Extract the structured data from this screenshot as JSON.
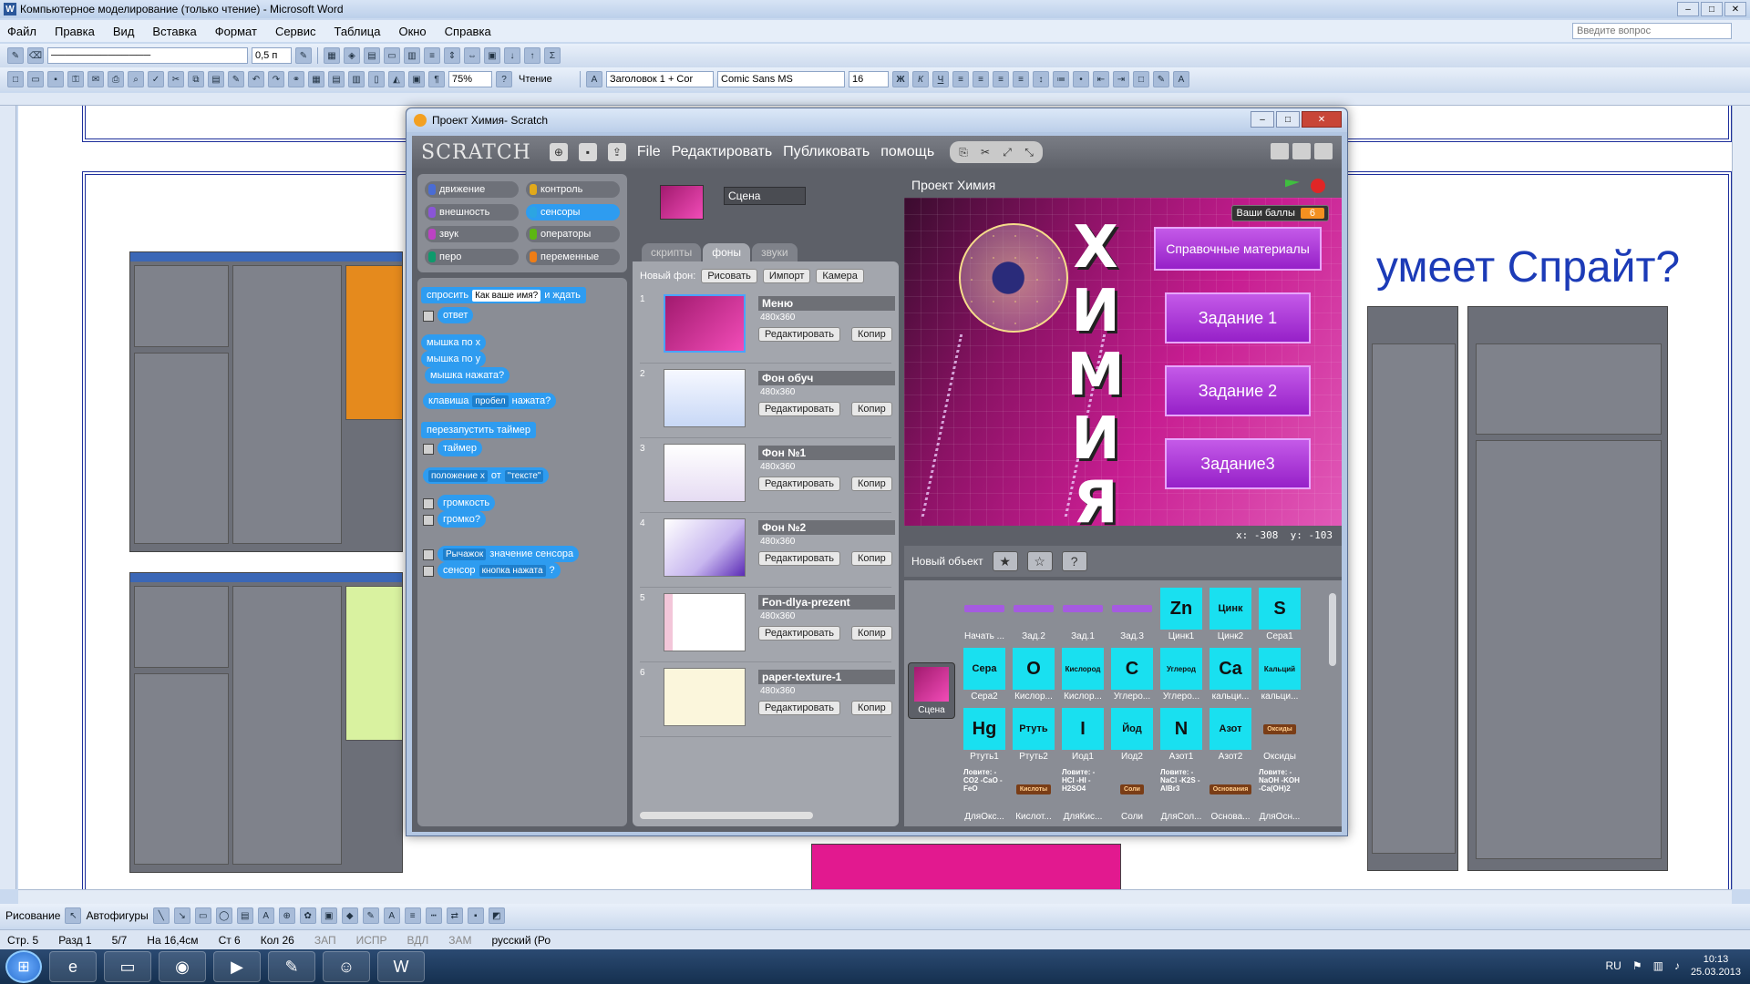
{
  "word": {
    "title": "Компьютерное моделирование (только чтение) - Microsoft Word",
    "menu": [
      "Файл",
      "Правка",
      "Вид",
      "Вставка",
      "Формат",
      "Сервис",
      "Таблица",
      "Окно",
      "Справка"
    ],
    "ask_placeholder": "Введите вопрос",
    "line_width": "0,5 п",
    "zoom": "75%",
    "reading": "Чтение",
    "style": "Заголовок 1 + Cor",
    "font": "Comic Sans MS",
    "font_size": "16",
    "heading_text": "умеет Спрайт?",
    "draw_label": "Рисование",
    "autoshapes_label": "Автофигуры",
    "status": {
      "page": "Стр. 5",
      "section": "Разд 1",
      "pages": "5/7",
      "at": "На 16,4см",
      "line": "Ст 6",
      "col": "Кол 26",
      "rec": "ЗАП",
      "trk": "ИСПР",
      "ext": "ВДЛ",
      "ovr": "ЗАМ",
      "lang": "русский (Ро"
    }
  },
  "taskbar": {
    "lang": "RU",
    "time": "10:13",
    "date": "25.03.2013"
  },
  "scratch": {
    "window_title": "Проект Химия- Scratch",
    "logo": "SCRATCH",
    "menu": [
      "File",
      "Редактировать",
      "Публиковать",
      "помощь"
    ],
    "categories": [
      {
        "label": "движение",
        "color": "#4a6cd4"
      },
      {
        "label": "контроль",
        "color": "#e1a91a"
      },
      {
        "label": "внешность",
        "color": "#8a55d7"
      },
      {
        "label": "сенсоры",
        "color": "#2ca5e2",
        "selected": true
      },
      {
        "label": "звук",
        "color": "#bb42c3"
      },
      {
        "label": "операторы",
        "color": "#5cb712"
      },
      {
        "label": "перо",
        "color": "#0e9a6c"
      },
      {
        "label": "переменные",
        "color": "#ee7d16"
      }
    ],
    "blocks": {
      "ask": "спросить",
      "ask_default": "Как ваше имя?",
      "ask_wait": "и ждать",
      "answer": "ответ",
      "mouse_x": "мышка по х",
      "mouse_y": "мышка по у",
      "mouse_down": "мышка нажата?",
      "key": "клавиша",
      "key_val": "пробел",
      "key_pressed": "нажата?",
      "reset_timer": "перезапустить таймер",
      "timer": "таймер",
      "position": "положение х",
      "of": "от",
      "of_val": "\"тексте\"",
      "loudness": "громкость",
      "loud": "громко?",
      "sensor_val_dd": "Рычажок",
      "sensor_value": "значение сенсора",
      "sensor": "сенсор",
      "sensor_dd": "кнопка нажата",
      "q": "?"
    },
    "sprite_name": "Сцена",
    "tabs": [
      "скрипты",
      "фоны",
      "звуки"
    ],
    "selected_tab": 1,
    "new_bg_label": "Новый фон:",
    "new_bg_buttons": [
      "Рисовать",
      "Импорт",
      "Камера"
    ],
    "backgrounds": [
      {
        "num": "1",
        "name": "Меню",
        "size": "480x360"
      },
      {
        "num": "2",
        "name": "Фон обуч",
        "size": "480x360"
      },
      {
        "num": "3",
        "name": "Фон №1",
        "size": "480x360"
      },
      {
        "num": "4",
        "name": "Фон №2",
        "size": "480x360"
      },
      {
        "num": "5",
        "name": "Fon-dlya-prezent",
        "size": "480x360"
      },
      {
        "num": "6",
        "name": "paper-texture-1",
        "size": "480x360"
      }
    ],
    "edit_label": "Редактировать",
    "copy_label": "Копир",
    "stage_title": "Проект Химия",
    "stage": {
      "chem_letters": [
        "Х",
        "И",
        "М",
        "И",
        "Я"
      ],
      "score_label": "Ваши баллы",
      "score_value": "6",
      "buttons": [
        "Справочные материалы",
        "Задание 1",
        "Задание 2",
        "Задание3"
      ]
    },
    "coords": {
      "x": "x: -308",
      "y": "y: -103"
    },
    "new_object_label": "Новый объект",
    "scene_tile_label": "Сцена",
    "sprites": [
      {
        "icon": "",
        "label": "Начать ..."
      },
      {
        "icon": "",
        "label": "Зад.2"
      },
      {
        "icon": "",
        "label": "Зад.1"
      },
      {
        "icon": "",
        "label": "Зад.3"
      },
      {
        "icon": "Zn",
        "label": "Цинк1"
      },
      {
        "icon": "Цинк",
        "label": "Цинк2"
      },
      {
        "icon": "S",
        "label": "Сера1"
      },
      {
        "icon": "Сера",
        "label": "Сера2"
      },
      {
        "icon": "O",
        "label": "Кислор..."
      },
      {
        "icon": "Кислород",
        "label": "Кислор..."
      },
      {
        "icon": "C",
        "label": "Углеро..."
      },
      {
        "icon": "Углерод",
        "label": "Углеро..."
      },
      {
        "icon": "Ca",
        "label": "кальци..."
      },
      {
        "icon": "Кальций",
        "label": "кальци..."
      },
      {
        "icon": "Hg",
        "label": "Ртуть1"
      },
      {
        "icon": "Ртуть",
        "label": "Ртуть2"
      },
      {
        "icon": "I",
        "label": "Иод1"
      },
      {
        "icon": "Йод",
        "label": "Иод2"
      },
      {
        "icon": "N",
        "label": "Азот1"
      },
      {
        "icon": "Азот",
        "label": "Азот2"
      },
      {
        "icon": "Оксиды",
        "label": "Оксиды"
      },
      {
        "icon": "Ловите: -CO2 -CaO -FeO",
        "label": "ДляОкс..."
      },
      {
        "icon": "Кислоты",
        "label": "Кислот..."
      },
      {
        "icon": "Ловите: -HCl -HI -H2SO4",
        "label": "ДляКис..."
      },
      {
        "icon": "Соли",
        "label": "Соли"
      },
      {
        "icon": "Ловите: -NaCl -K2S -AlBr3",
        "label": "ДляСол..."
      },
      {
        "icon": "Основания",
        "label": "Основа..."
      },
      {
        "icon": "Ловите: -NaOH -KOH -Ca(OH)2",
        "label": "ДляОсн..."
      }
    ]
  }
}
